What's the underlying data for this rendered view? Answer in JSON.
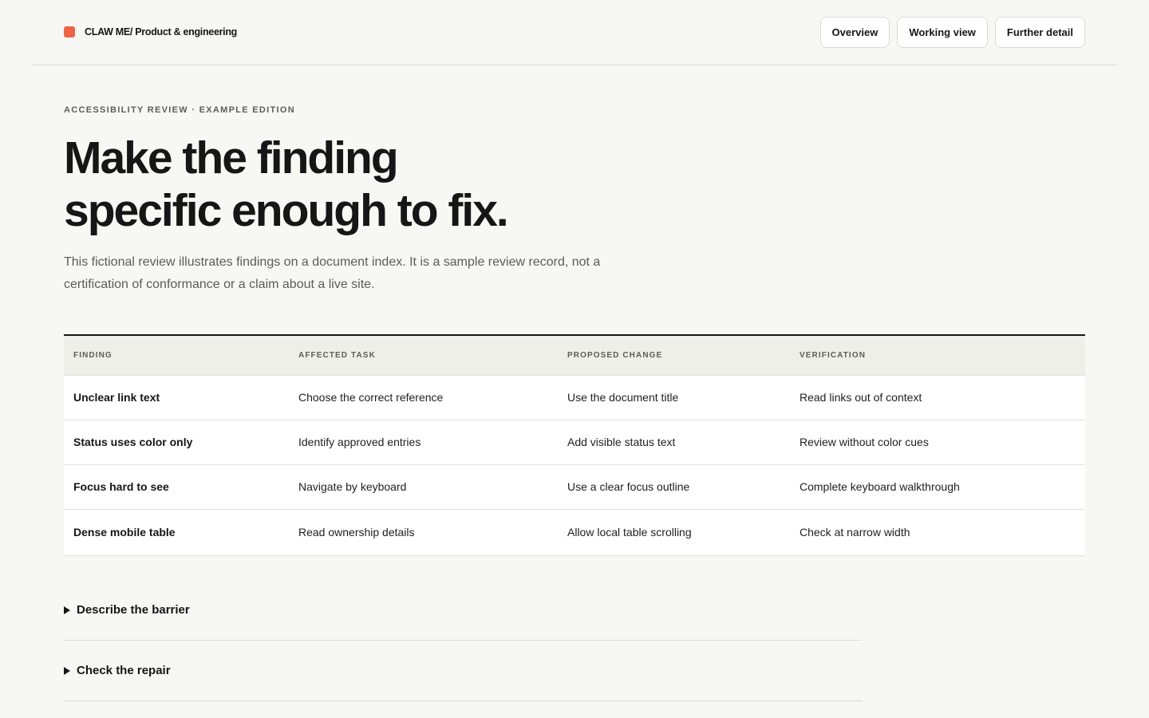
{
  "header": {
    "brand": "CLAW ME/ Product & engineering",
    "brand_color": "#ef6448",
    "nav": [
      "Overview",
      "Working view",
      "Further detail"
    ]
  },
  "hero": {
    "eyebrow": "ACCESSIBILITY REVIEW · EXAMPLE EDITION",
    "headline": [
      "Make the finding",
      "specific enough to fix."
    ],
    "intro": [
      "This fictional review illustrates findings on a document index. It is a sample review record, not a",
      "certification of conformance or a claim about a live site."
    ]
  },
  "table": {
    "columns": [
      "FINDING",
      "AFFECTED TASK",
      "PROPOSED CHANGE",
      "VERIFICATION"
    ],
    "rows": [
      [
        "Unclear link text",
        "Choose the correct reference",
        "Use the document title",
        "Read links out of context"
      ],
      [
        "Status uses color only",
        "Identify approved entries",
        "Add visible status text",
        "Review without color cues"
      ],
      [
        "Focus hard to see",
        "Navigate by keyboard",
        "Use a clear focus outline",
        "Complete keyboard walkthrough"
      ],
      [
        "Dense mobile table",
        "Read ownership details",
        "Allow local table scrolling",
        "Check at narrow width"
      ]
    ]
  },
  "accordions": [
    "Describe the barrier",
    "Check the repair"
  ]
}
